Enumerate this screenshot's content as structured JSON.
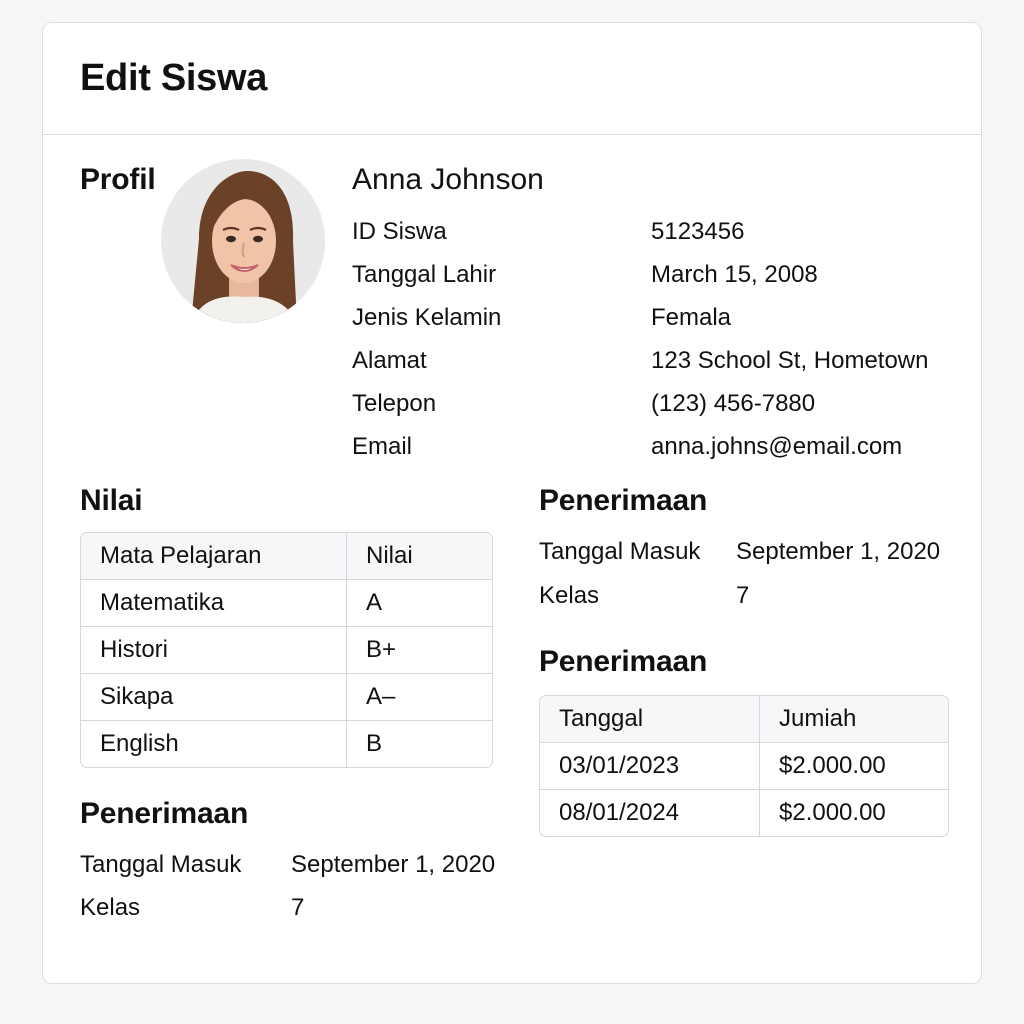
{
  "header": {
    "title": "Edit Siswa"
  },
  "profile": {
    "section_title": "Profil",
    "name": "Anna Johnson",
    "fields": [
      {
        "label": "ID Siswa",
        "value": "5123456"
      },
      {
        "label": "Tanggal Lahir",
        "value": "March 15, 2008"
      },
      {
        "label": "Jenis Kelamin",
        "value": "Femala"
      },
      {
        "label": "Alamat",
        "value": "123 School St, Hometown"
      },
      {
        "label": "Telepon",
        "value": "(123) 456-7880"
      },
      {
        "label": "Email",
        "value": "anna.johns@email.com"
      }
    ]
  },
  "grades": {
    "section_title": "Nilai",
    "columns": [
      "Mata Pelajaran",
      "Nilai"
    ],
    "rows": [
      [
        "Matematika",
        "A"
      ],
      [
        "Histori",
        "B+"
      ],
      [
        "Sikapa",
        "A–"
      ],
      [
        "English",
        "B"
      ]
    ]
  },
  "admission_left": {
    "section_title": "Penerimaan",
    "fields": [
      {
        "label": "Tanggal Masuk",
        "value": "September 1, 2020"
      },
      {
        "label": "Kelas",
        "value": "7"
      }
    ]
  },
  "admission_right": {
    "section_title": "Penerimaan",
    "fields": [
      {
        "label": "Tanggal Masuk",
        "value": "September 1, 2020"
      },
      {
        "label": "Kelas",
        "value": "7"
      }
    ]
  },
  "payments": {
    "section_title": "Penerimaan",
    "columns": [
      "Tanggal",
      "Jumiah"
    ],
    "rows": [
      [
        "03/01/2023",
        "$2.000.00"
      ],
      [
        "08/01/2024",
        "$2.000.00"
      ]
    ]
  }
}
